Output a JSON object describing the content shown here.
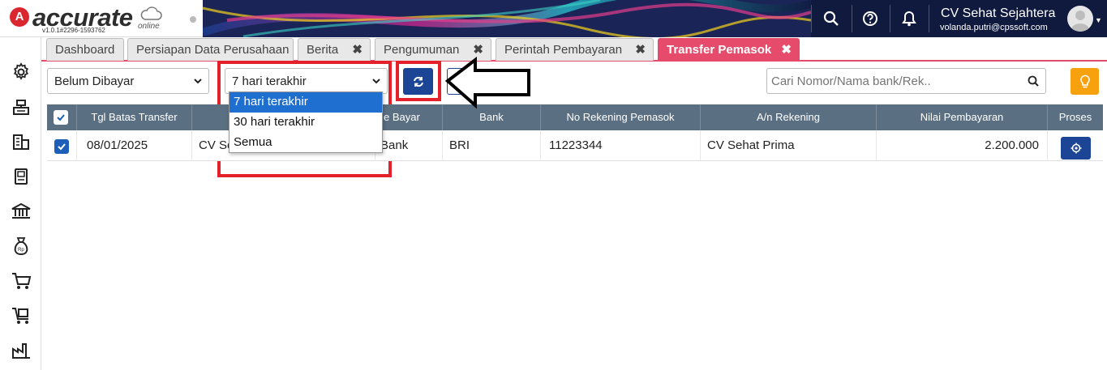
{
  "app": {
    "logo_text": "accurate",
    "logo_sub": "online",
    "version": "v1.0.1#2296-1593762",
    "company": "CV Sehat Sejahtera",
    "user_email": "volanda.putri@cpssoft.com"
  },
  "header_icons": [
    "search-icon",
    "help-icon",
    "bell-icon"
  ],
  "sidebar_icons": [
    "gear-icon",
    "cash-register-icon",
    "building-icon",
    "book-icon",
    "bank-icon",
    "money-bag-icon",
    "cart-icon",
    "cart-box-icon",
    "factory-icon"
  ],
  "tabs": [
    {
      "label": "Dashboard",
      "closable": false
    },
    {
      "label": "Persiapan Data Perusahaan",
      "closable": false
    },
    {
      "label": "Berita",
      "closable": true
    },
    {
      "label": "Pengumuman",
      "closable": true
    },
    {
      "label": "Perintah Pembayaran",
      "closable": true
    },
    {
      "label": "Transfer Pemasok",
      "closable": true,
      "active": true
    }
  ],
  "tab_count": "6",
  "toolbar": {
    "status_filter": "Belum Dibayar",
    "period_filter": "7 hari terakhir",
    "period_options": [
      "7 hari terakhir",
      "30 hari terakhir",
      "Semua"
    ],
    "search_placeholder": "Cari Nomor/Nama bank/Rek.."
  },
  "table": {
    "headers": [
      "Tgl Batas Transfer",
      "",
      "e Bayar",
      "Bank",
      "No Rekening Pemasok",
      "A/n Rekening",
      "Nilai Pembayaran",
      "Proses"
    ],
    "rows": [
      {
        "checked": true,
        "tgl": "08/01/2025",
        "pemasok": "CV Se",
        "cara_bayar": "Bank",
        "bank": "BRI",
        "no_rekening": "11223344",
        "an_rekening": "CV Sehat Prima",
        "nilai": "2.200.000"
      }
    ]
  },
  "colors": {
    "accent": "#e64b6c",
    "primary": "#1d4595",
    "header_bg": "#5a6f82",
    "highlight": "#e4202a",
    "bulb": "#f8a10f"
  }
}
